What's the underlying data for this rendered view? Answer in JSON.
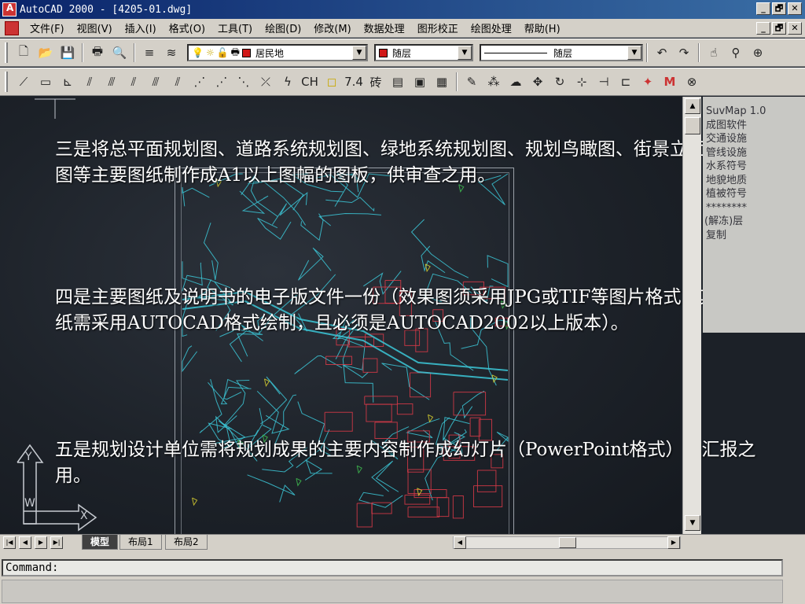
{
  "window": {
    "title": "AutoCAD 2000 - [4205-01.dwg]",
    "controls": [
      "_",
      "🗗",
      "✕"
    ]
  },
  "menu": {
    "items": [
      "文件(F)",
      "视图(V)",
      "插入(I)",
      "格式(O)",
      "工具(T)",
      "绘图(D)",
      "修改(M)",
      "数据处理",
      "图形校正",
      "绘图处理",
      "帮助(H)"
    ]
  },
  "toolbar": {
    "layer_value": "居民地",
    "color_value": "随层",
    "linetype_value": "随层"
  },
  "toolbar2": {
    "ch_label": "CH",
    "num_label": "7.4",
    "brick_label": "砖"
  },
  "colors": {
    "layer_swatch": "#d01818",
    "map_cyan": "#3cc8d8",
    "map_red": "#d83a48",
    "map_yellow": "#d8d030",
    "map_green": "#40c050"
  },
  "side_panel": {
    "items": [
      "SuvMap 1.0",
      "成图软件",
      "",
      "",
      "交通设施",
      "管线设施",
      "水系符号",
      "地貌地质",
      "植被符号",
      "********",
      "",
      "(解冻)层",
      "",
      "复制"
    ]
  },
  "slide": {
    "p1": "三是将总平面规划图、道路系统规划图、绿地系统规划图、规划鸟瞰图、街景立面图、效果图等主要图纸制作成A1以上图幅的图板，供审查之用。",
    "p2": "四是主要图纸及说明书的电子版文件一份（效果图须采用JPG或TIF等图片格式，其他图纸需采用AUTOCAD格式绘制，且必须是AUTOCAD2002以上版本）。",
    "p3": "五是规划设计单位需将规划成果的主要内容制作成幻灯片（PowerPoint格式）供汇报之用。"
  },
  "ucs": {
    "y_label": "Y",
    "w_label": "W",
    "x_label": "X"
  },
  "tabs": [
    "模型",
    "布局1",
    "布局2"
  ],
  "command": {
    "prompt": "Command:"
  }
}
